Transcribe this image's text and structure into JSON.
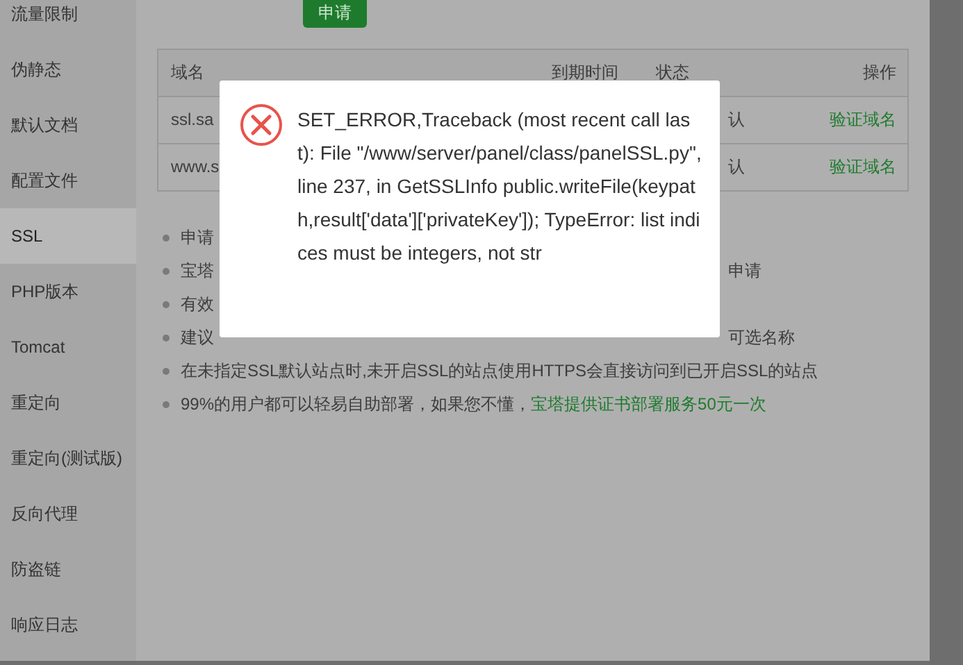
{
  "sidebar": {
    "items": [
      {
        "label": "流量限制",
        "selected": false
      },
      {
        "label": "伪静态",
        "selected": false
      },
      {
        "label": "默认文档",
        "selected": false
      },
      {
        "label": "配置文件",
        "selected": false
      },
      {
        "label": "SSL",
        "selected": true
      },
      {
        "label": "PHP版本",
        "selected": false
      },
      {
        "label": "Tomcat",
        "selected": false
      },
      {
        "label": "重定向",
        "selected": false
      },
      {
        "label": "重定向(测试版)",
        "selected": false
      },
      {
        "label": "反向代理",
        "selected": false
      },
      {
        "label": "防盗链",
        "selected": false
      },
      {
        "label": "响应日志",
        "selected": false
      }
    ]
  },
  "apply_button": "申请",
  "table": {
    "columns": [
      "域名",
      "到期时间",
      "状态",
      "操作"
    ],
    "rows": [
      {
        "domain": "ssl.sa",
        "status": "认",
        "action": "验证域名"
      },
      {
        "domain": "www.s",
        "status": "认",
        "action": "验证域名"
      }
    ]
  },
  "notes": [
    {
      "text": "申请"
    },
    {
      "text": "宝塔",
      "tail": "申请"
    },
    {
      "text": "有效"
    },
    {
      "text": "建议",
      "tail": "可选名称"
    },
    {
      "text": "在未指定SSL默认站点时,未开启SSL的站点使用HTTPS会直接访问到已开启SSL的站点"
    },
    {
      "text": "99%的用户都可以轻易自助部署，如果您不懂，",
      "link": "宝塔提供证书部署服务50元一次"
    }
  ],
  "dialog": {
    "kind": "error",
    "message": "SET_ERROR,Traceback (most recent call last): File \"/www/server/panel/class/panelSSL.py\", line 237, in GetSSLInfo public.writeFile(keypath,result['data']['privateKey']); TypeError: list indices must be integers, not str"
  }
}
